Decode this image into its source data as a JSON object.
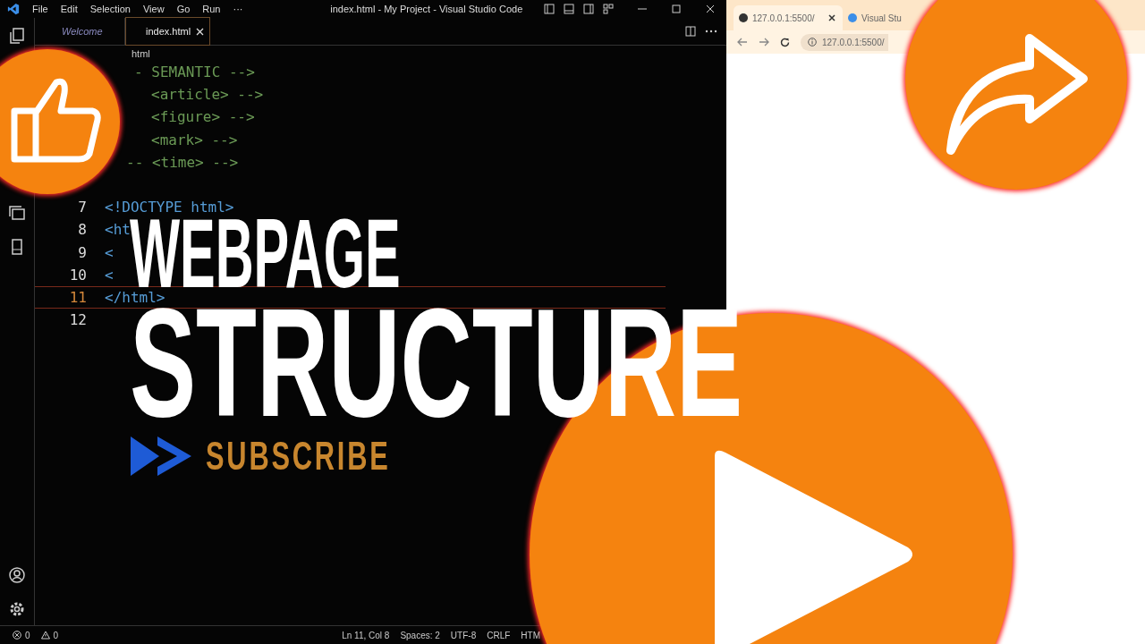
{
  "window": {
    "title": "index.html - My Project - Visual Studio Code"
  },
  "menu": [
    "File",
    "Edit",
    "Selection",
    "View",
    "Go",
    "Run",
    "···"
  ],
  "tabs": [
    {
      "label": "Welcome",
      "selected": false
    },
    {
      "label": "index.html",
      "selected": true
    }
  ],
  "breadcrumb": "html",
  "code_lines": [
    {
      "code": "- SEMANTIC -->",
      "kind": "comment-open"
    },
    {
      "code": "<article> -->",
      "kind": "comment"
    },
    {
      "code": "<figure> -->",
      "kind": "comment"
    },
    {
      "code": "<mark> -->",
      "kind": "comment"
    },
    {
      "code": "-- <time> -->",
      "kind": "comment-wide"
    },
    {
      "kind": "blank"
    },
    {
      "number": "7",
      "code": "<!DOCTYPE html>",
      "kind": "tag"
    },
    {
      "number": "8",
      "code": "<ht",
      "kind": "tag"
    },
    {
      "number": "9",
      "code": "<",
      "kind": "tag"
    },
    {
      "number": "10",
      "code": "<",
      "kind": "tag"
    },
    {
      "number": "11",
      "code": "</html>",
      "kind": "current"
    },
    {
      "number": "12",
      "kind": "blank"
    }
  ],
  "status_bar": {
    "errors": "0",
    "warnings": "0",
    "items": [
      "Ln 11, Col 8",
      "Spaces: 2",
      "UTF-8",
      "CRLF",
      "HTM"
    ]
  },
  "browser": {
    "tabs": [
      {
        "label": "127.0.0.1:5500/",
        "selected": true
      },
      {
        "label": "Visual Stu",
        "selected": false
      }
    ],
    "address": "127.0.0.1:5500/"
  },
  "overlay": {
    "title_lines": [
      "WEBPAGE",
      "STRUCTURE"
    ],
    "subscribe": "SUBSCRIBE"
  }
}
